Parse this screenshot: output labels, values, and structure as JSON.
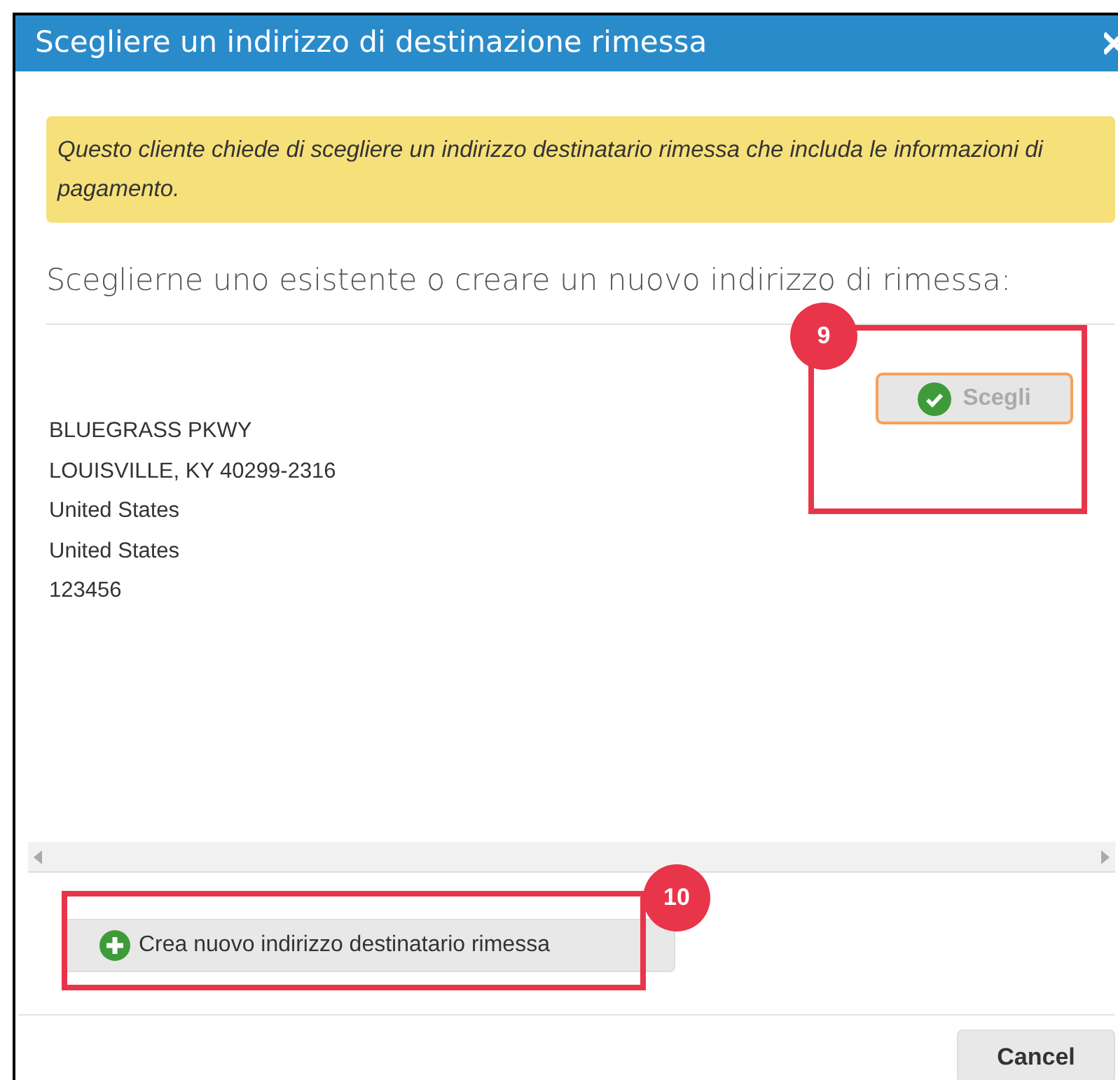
{
  "dialog": {
    "title": "Scegliere un indirizzo di destinazione rimessa"
  },
  "notice": "Questo cliente chiede di scegliere un indirizzo destinatario rimessa che includa le informazioni di pagamento.",
  "heading": "Sceglierne uno esistente o creare un nuovo indirizzo di rimessa:",
  "addresses": [
    {
      "lines": [
        "BLUEGRASS PKWY",
        "LOUISVILLE, KY 40299-2316",
        "United States",
        "United States",
        "123456"
      ],
      "choose_button": {
        "label": "Scegli",
        "disabled": true
      }
    }
  ],
  "create_button": "Crea nuovo indirizzo destinatario rimessa",
  "footer_buttons": [
    "Cancel"
  ],
  "callouts": [
    {
      "number": "9",
      "kind": "choose"
    },
    {
      "number": "10",
      "kind": "create"
    }
  ]
}
